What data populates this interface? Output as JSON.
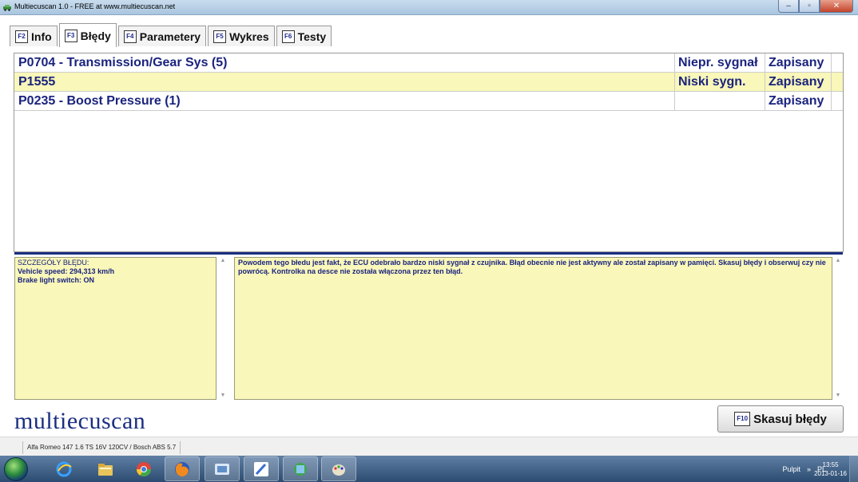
{
  "window": {
    "title": "Multiecuscan 1.0 - FREE at www.multiecuscan.net",
    "min_glyph": "–",
    "max_glyph": "▫",
    "close_glyph": "✕"
  },
  "tabs": [
    {
      "key": "F2",
      "label": "Info",
      "active": false
    },
    {
      "key": "F3",
      "label": "Błędy",
      "active": true
    },
    {
      "key": "F4",
      "label": "Parametery",
      "active": false
    },
    {
      "key": "F5",
      "label": "Wykres",
      "active": false
    },
    {
      "key": "F6",
      "label": "Testy",
      "active": false
    }
  ],
  "errors": [
    {
      "code": "P0704 - Transmission/Gear Sys (5)",
      "signal": "Niepr. sygnał",
      "status": "Zapisany",
      "highlighted": false
    },
    {
      "code": "P1555",
      "signal": "Niski sygn.",
      "status": "Zapisany",
      "highlighted": true
    },
    {
      "code": "P0235 - Boost Pressure (1)",
      "signal": "",
      "status": "Zapisany",
      "highlighted": false
    }
  ],
  "details": {
    "header": "SZCZEGÓŁY BŁĘDU:",
    "lines": [
      "Vehicle speed: 294,313 km/h",
      "Brake light switch: ON"
    ]
  },
  "description": "Powodem tego błedu jest fakt, że ECU odebrało bardzo niski sygnał z czujnika. Błąd obecnie nie jest aktywny ale został zapisany w pamięci. Skasuj błędy i obserwuj czy nie powrócą. Kontrolka na desce nie została włączona przez ten błąd.",
  "brand": "multiecuscan",
  "clear_button": {
    "key": "F10",
    "label": "Skasuj błędy"
  },
  "status_bar": {
    "vehicle": "Alfa Romeo 147 1.6 TS 16V 120CV / Bosch ABS 5.7"
  },
  "taskbar": {
    "apps": [
      "start-orb",
      "ie-icon",
      "explorer-icon",
      "chrome-icon",
      "firefox-icon",
      "multiecuscan-icon",
      "pen-icon",
      "network-icon",
      "paint-icon"
    ],
    "tray_label": "Pulpit",
    "tray_chevron": "»",
    "language": "PL",
    "time": "13:55",
    "date": "2013-01-16"
  },
  "colors": {
    "accent": "#1a237e",
    "highlight": "#f9f7b9",
    "divider": "#1a2e80"
  }
}
